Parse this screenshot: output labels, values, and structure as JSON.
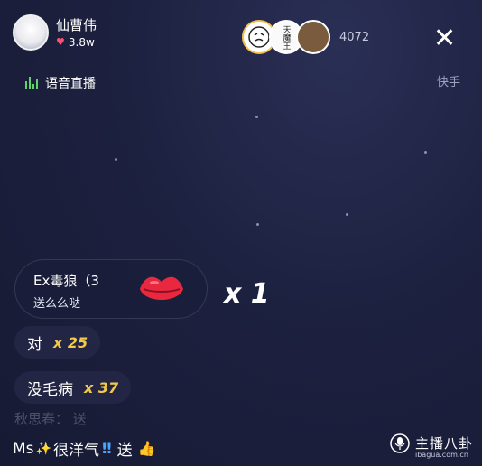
{
  "host": {
    "name": "仙曹伟",
    "likes": "3.8w"
  },
  "voice_label": "语音直播",
  "viewers": {
    "avatar1_text": "",
    "avatar2_text": "天魔王",
    "count": "4072"
  },
  "close_icon": "close-icon",
  "brand": "快手",
  "gift": {
    "user": "Ex毒狼（3",
    "text": "送么么哒",
    "count": "x 1",
    "icon": "lips-icon"
  },
  "combo_messages": [
    {
      "text": "对",
      "count": "x 25"
    },
    {
      "text": "没毛病",
      "count": "x 37"
    }
  ],
  "faded_message": "秋思春：  送",
  "chat_message": {
    "user": "Ms",
    "text": "很洋气",
    "suffix": "送"
  },
  "watermark": {
    "main": "主播八卦",
    "sub": "ibagua.com.cn"
  },
  "colors": {
    "background": "#1d2140",
    "accent_yellow": "#f2c94c",
    "heart": "#ff4f6f",
    "voice_bars": "#5fd46b"
  }
}
